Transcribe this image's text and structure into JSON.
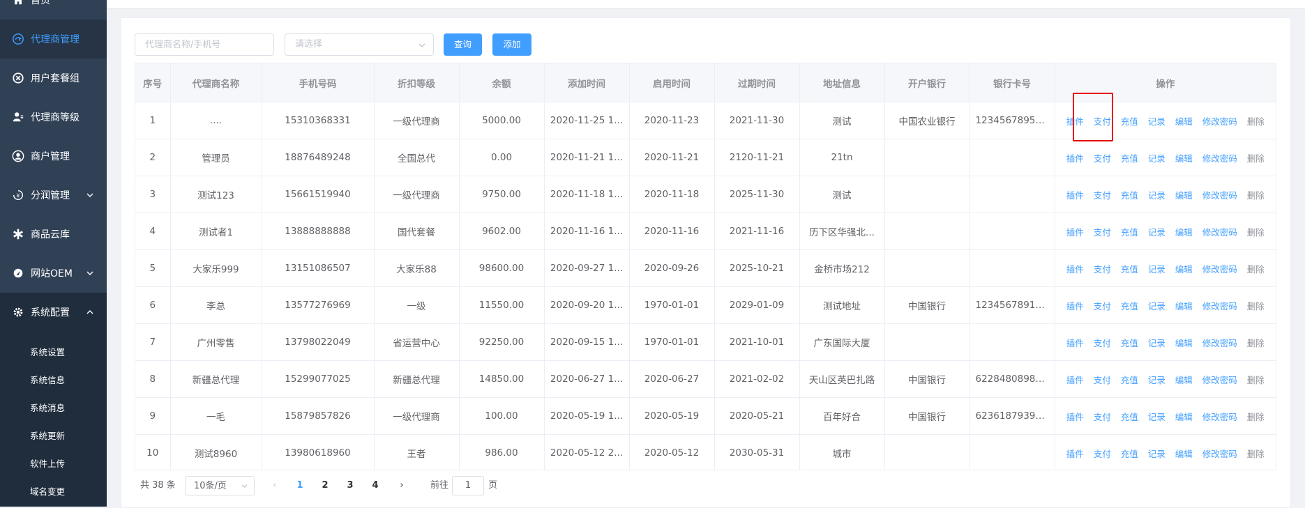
{
  "sidebar": {
    "items": [
      {
        "label": "首页",
        "icon": "home-icon"
      },
      {
        "label": "代理商管理",
        "icon": "agent-icon",
        "active": true
      },
      {
        "label": "用户套餐组",
        "icon": "package-icon"
      },
      {
        "label": "代理商等级",
        "icon": "level-icon"
      },
      {
        "label": "商户管理",
        "icon": "user-circle-icon"
      },
      {
        "label": "分润管理",
        "icon": "profit-icon",
        "has_arrow": true
      },
      {
        "label": "商品云库",
        "icon": "asterisk-icon"
      },
      {
        "label": "网站OEM",
        "icon": "website-icon",
        "has_arrow": true
      },
      {
        "label": "系统配置",
        "icon": "gear-icon",
        "has_arrow": true,
        "open": true
      }
    ],
    "submenu": [
      "系统设置",
      "系统信息",
      "系统消息",
      "系统更新",
      "软件上传",
      "域名变更"
    ]
  },
  "toolbar": {
    "search_placeholder": "代理商名称/手机号",
    "select_placeholder": "请选择",
    "query_label": "查询",
    "add_label": "添加"
  },
  "table": {
    "columns": [
      "序号",
      "代理商名称",
      "手机号码",
      "折扣等级",
      "余额",
      "添加时间",
      "启用时间",
      "过期时间",
      "地址信息",
      "开户银行",
      "银行卡号",
      "操作"
    ],
    "operations": [
      "插件",
      "支付",
      "充值",
      "记录",
      "编辑",
      "修改密码",
      "删除"
    ],
    "rows": [
      [
        "1",
        "....",
        "15310368331",
        "一级代理商",
        "5000.00",
        "2020-11-25 1...",
        "2020-11-23",
        "2021-11-30",
        "测试",
        "中国农业银行",
        "12345678951..."
      ],
      [
        "2",
        "管理员",
        "18876489248",
        "全国总代",
        "0.00",
        "2020-11-21 1...",
        "2020-11-21",
        "2120-11-21",
        "21tn",
        "",
        ""
      ],
      [
        "3",
        "测试123",
        "15661519940",
        "一级代理商",
        "9750.00",
        "2020-11-18 1...",
        "2020-11-18",
        "2025-11-30",
        "测试",
        "",
        ""
      ],
      [
        "4",
        "测试者1",
        "13888888888",
        "国代套餐",
        "9602.00",
        "2020-11-16 1...",
        "2020-11-16",
        "2021-11-16",
        "历下区华强北...",
        "",
        ""
      ],
      [
        "5",
        "大家乐999",
        "13151086507",
        "大家乐88",
        "98600.00",
        "2020-09-27 1...",
        "2020-09-26",
        "2025-10-21",
        "金桥市场212",
        "",
        ""
      ],
      [
        "6",
        "李总",
        "13577276969",
        "一级",
        "11550.00",
        "2020-09-20 1...",
        "1970-01-01",
        "2029-01-09",
        "测试地址",
        "中国银行",
        "12345678912..."
      ],
      [
        "7",
        "广州零售",
        "13798022049",
        "省运营中心",
        "92250.00",
        "2020-09-15 1...",
        "1970-01-01",
        "2021-10-01",
        "广东国际大厦",
        "",
        ""
      ],
      [
        "8",
        "新疆总代理",
        "15299077025",
        "新疆总代理",
        "14850.00",
        "2020-06-27 1...",
        "2020-06-27",
        "2021-02-02",
        "天山区英巴扎路",
        "中国银行",
        "62284808982..."
      ],
      [
        "9",
        "一毛",
        "15879857826",
        "一级代理商",
        "100.00",
        "2020-05-19 1...",
        "2020-05-19",
        "2020-05-21",
        "百年好合",
        "中国银行",
        "62361879392..."
      ],
      [
        "10",
        "测试8960",
        "13980618960",
        "王者",
        "986.00",
        "2020-05-12 2...",
        "2020-05-12",
        "2030-05-31",
        "城市",
        "",
        ""
      ]
    ]
  },
  "pagination": {
    "total_label": "共 38 条",
    "page_size": "10条/页",
    "pages": [
      "1",
      "2",
      "3",
      "4"
    ],
    "current": "1",
    "goto_label": "前往",
    "goto_value": "1",
    "goto_unit": "页"
  },
  "colors": {
    "accent": "#409eff",
    "sidebar": "#304156",
    "highlight": "#e60000"
  }
}
